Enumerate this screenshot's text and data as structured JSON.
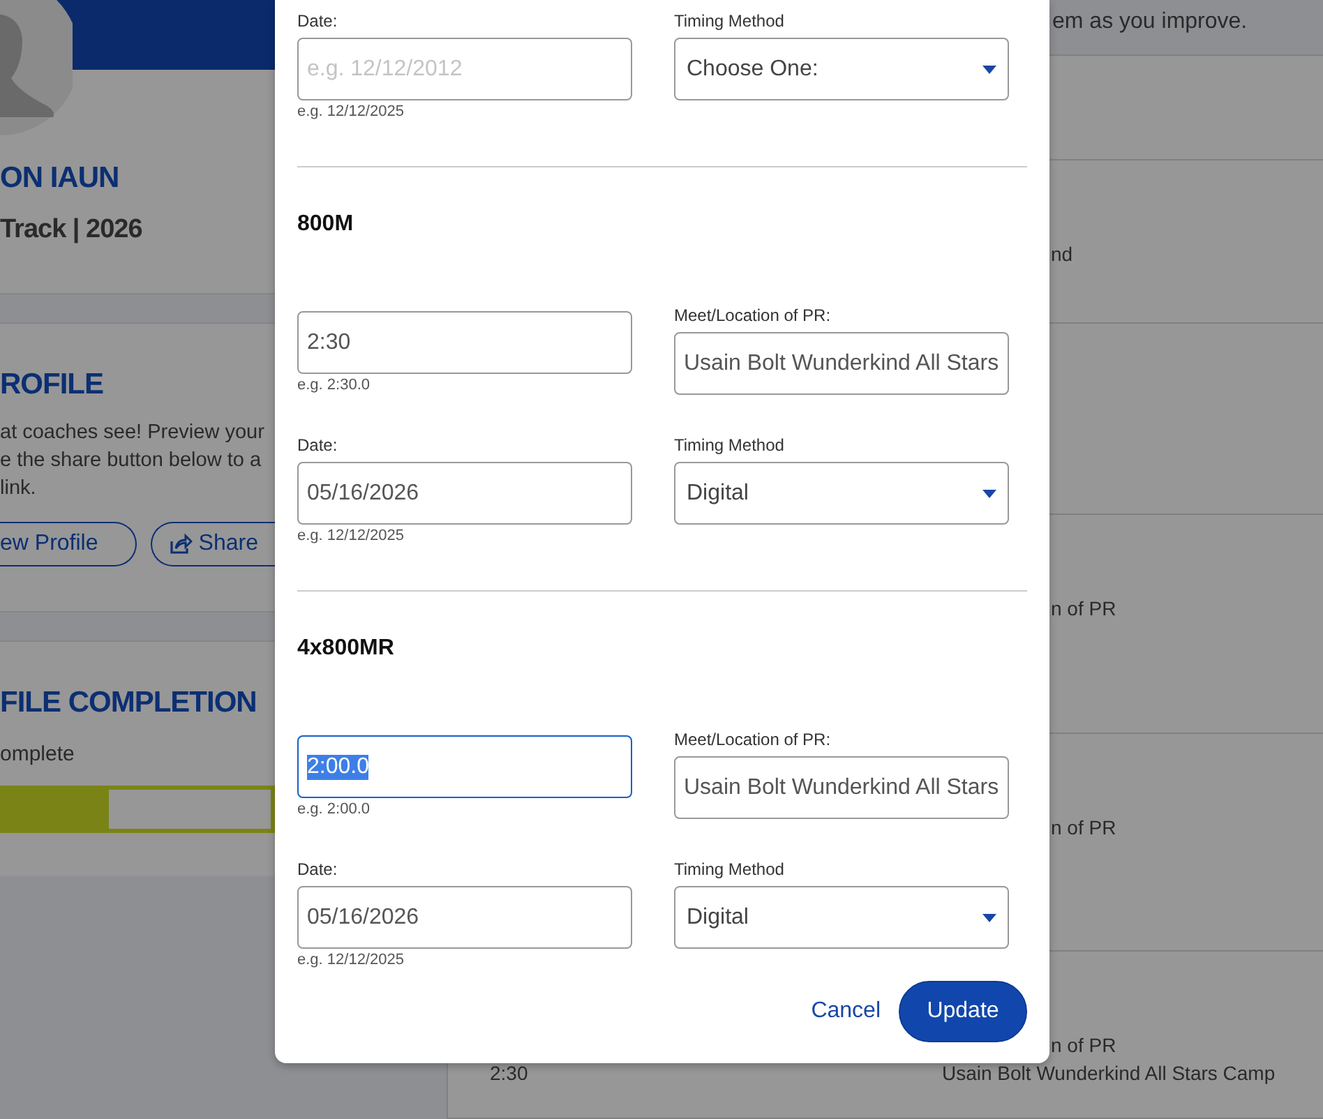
{
  "sidebar": {
    "name": "ON IAUN",
    "subtitle": "Track | 2026",
    "profile_card": {
      "title": "ROFILE",
      "text": "at coaches see! Preview your\ne the share button below to a\nlink.",
      "buttons": [
        "ew Profile",
        "Share"
      ]
    },
    "completion_card": {
      "title": "FILE COMPLETION",
      "status": "omplete",
      "level": 0.4
    }
  },
  "content": {
    "intro": "em as you improve.",
    "rows": [
      {
        "label": "nd"
      },
      {
        "label": "n of PR"
      },
      {
        "label": "n of PR"
      },
      {
        "label": "n of PR",
        "mark": "2:30",
        "location": "Usain Bolt Wunderkind All Stars Camp"
      }
    ]
  },
  "modal": {
    "first": {
      "date_label": "Date:",
      "date_placeholder": "e.g. 12/12/2012",
      "date_hint": "e.g. 12/12/2025",
      "timing_label": "Timing Method",
      "timing_value": "Choose One:"
    },
    "events": [
      {
        "name": "800M",
        "mark_value": "2:30",
        "mark_hint": "e.g. 2:30.0",
        "focused": false,
        "meet_label": "Meet/Location of PR:",
        "meet_value": "Usain Bolt Wunderkind All Stars",
        "date_label": "Date:",
        "date_value": "05/16/2026",
        "date_hint": "e.g. 12/12/2025",
        "timing_label": "Timing Method",
        "timing_value": "Digital"
      },
      {
        "name": "4x800MR",
        "mark_value": "2:00.0",
        "mark_hint": "e.g. 2:00.0",
        "focused": true,
        "meet_label": "Meet/Location of PR:",
        "meet_value": "Usain Bolt Wunderkind All Stars",
        "date_label": "Date:",
        "date_value": "05/16/2026",
        "date_hint": "e.g. 12/12/2025",
        "timing_label": "Timing Method",
        "timing_value": "Digital"
      }
    ],
    "cancel": "Cancel",
    "update": "Update"
  }
}
